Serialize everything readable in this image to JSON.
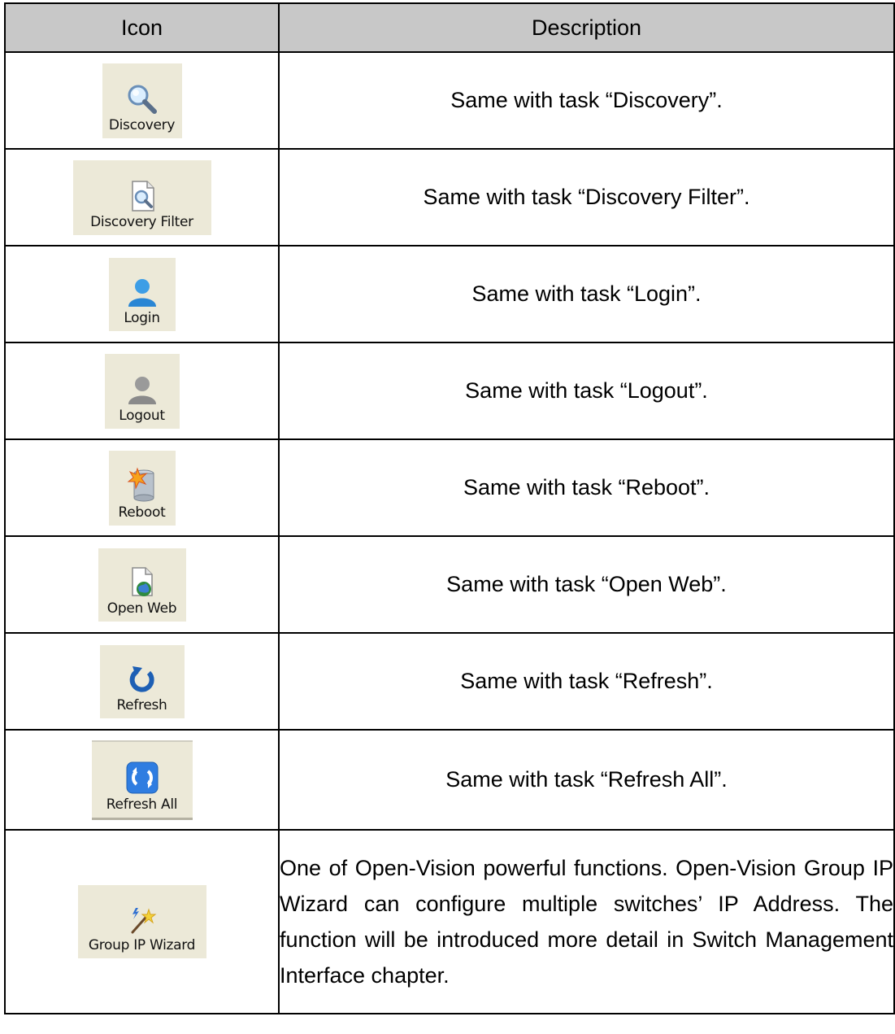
{
  "table": {
    "headers": [
      "Icon",
      "Description"
    ],
    "rows": [
      {
        "icon": "discovery-icon",
        "label": "Discovery",
        "description": "Same with task “Discovery”."
      },
      {
        "icon": "discovery-filter-icon",
        "label": "Discovery Filter",
        "description": "Same with task “Discovery Filter”."
      },
      {
        "icon": "login-user-icon",
        "label": "Login",
        "description": "Same with task “Login”."
      },
      {
        "icon": "logout-user-icon",
        "label": "Logout",
        "description": "Same with task “Logout”."
      },
      {
        "icon": "reboot-icon",
        "label": "Reboot",
        "description": "Same with task “Reboot”."
      },
      {
        "icon": "open-web-icon",
        "label": "Open Web",
        "description": "Same with task “Open Web”."
      },
      {
        "icon": "refresh-icon",
        "label": "Refresh",
        "description": "Same with task “Refresh”."
      },
      {
        "icon": "refresh-all-icon",
        "label": "Refresh All",
        "description": "Same with task “Refresh All”."
      },
      {
        "icon": "group-ip-wizard-icon",
        "label": "Group IP Wizard",
        "description": "One of Open-Vision powerful functions. Open-Vision Group IP Wizard can configure multiple switches’ IP Address. The function will be introduced more detail in Switch Management Interface chapter."
      }
    ]
  }
}
